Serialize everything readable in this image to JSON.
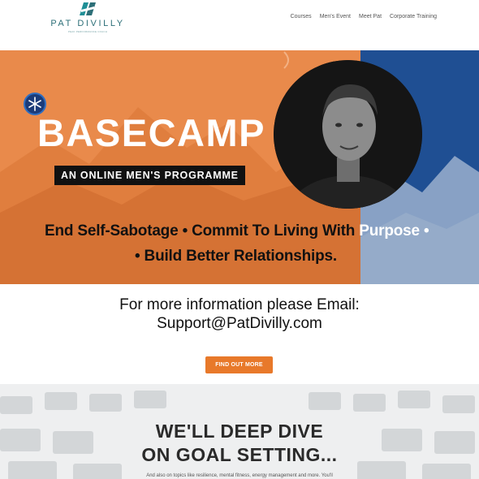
{
  "header": {
    "logo_name": "PAT DIVILLY",
    "logo_tagline": "PEAK PERFORMANCE COACH",
    "nav": [
      "Courses",
      "Men's Event",
      "Meet Pat",
      "Corporate Training"
    ]
  },
  "hero": {
    "title": "BASECAMP",
    "subtitle": "AN ONLINE MEN'S PROGRAMME",
    "line1_a": "End Self-Sabotage",
    "line1_b": "Commit To Living With",
    "line1_c": "Purpose",
    "line2": "Build Better Relationships.",
    "bullet": "•"
  },
  "info": {
    "line1": "For more information please Email:",
    "line2": "Support@PatDivilly.com"
  },
  "cta": {
    "label": "FIND OUT MORE"
  },
  "section": {
    "title_line1": "WE'LL DEEP DIVE",
    "title_line2": "ON GOAL SETTING...",
    "body": "And also on topics like resilience, mental fitness, energy management and more. You'll"
  },
  "colors": {
    "accent_orange": "#e8792a",
    "hero_orange": "#e98a4b",
    "hero_blue": "#1f4f93",
    "logo_teal": "#2d6f78"
  },
  "icons": [
    "logo-mark-icon",
    "snowflake-badge-icon"
  ]
}
